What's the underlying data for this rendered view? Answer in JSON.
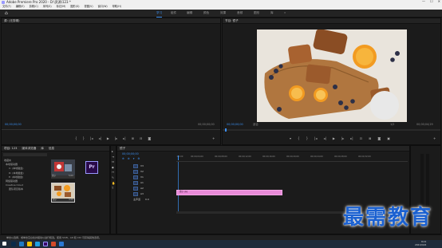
{
  "titlebar": {
    "title": "Adobe Premiere Pro 2020 - D:\\资源\\123 *",
    "min": "—",
    "max": "☐",
    "close": "✕"
  },
  "menu": [
    "文件(F)",
    "编辑(E)",
    "剪辑(C)",
    "序列(S)",
    "标记(M)",
    "图形(G)",
    "视图(V)",
    "窗口(W)",
    "帮助(H)"
  ],
  "workspaces": {
    "items": [
      "学习",
      "组件",
      "编辑",
      "颜色",
      "效果",
      "音频",
      "图形",
      "库"
    ],
    "active_index": 0,
    "more": "»"
  },
  "source_monitor": {
    "title": "源: (无剪辑)",
    "tc_left": "00;00;00;00",
    "tc_right": "00;00;00;00"
  },
  "program_monitor": {
    "title": "节目: 镜子",
    "tc_current": "00;00;00;00",
    "fit": "适合",
    "quality": "1/2",
    "tc_end": "00;00;04;29"
  },
  "project": {
    "tabs": [
      "项目: 123",
      "媒体浏览器",
      "库",
      "信息"
    ],
    "tree": [
      "收藏夹",
      "本地驱动器",
      "C: (本地磁盘)",
      "D: (本地磁盘)",
      "E: (本地磁盘)",
      "网络驱动器",
      "Creative Cloud",
      "团队项目版本"
    ],
    "bins": [
      {
        "name": "镜子",
        "duration": "5;00",
        "kind": "photo"
      },
      {
        "name": "Pr",
        "duration": "",
        "kind": "pr"
      },
      {
        "name": "镜子",
        "duration": "4;29",
        "kind": "food"
      }
    ],
    "pr_label": "Pr"
  },
  "timeline": {
    "title": "镜子",
    "timecode": "00;00;00;00",
    "ruler": [
      ":00;00",
      "00;00;04;00",
      "00;00;08;00",
      "00;00;12;00",
      "00;00;16;00",
      "00;00;20;00",
      "00;00;24;00",
      "00;00;28;00",
      "00;00;32;00"
    ],
    "video_tracks": [
      "V3",
      "V2",
      "V1"
    ],
    "audio_tracks": [
      "A1",
      "A2",
      "A3"
    ],
    "master": "主声道",
    "master_val": "0.0",
    "clip": "镜子.jpg"
  },
  "status": {
    "text": "单击以选择，或单击空白处并拖动以进行框选。使用 Shift、Alt 和 Ctrl 可获得其他选项。"
  },
  "watermark": "最需教育",
  "taskbar": {
    "time": "8:21",
    "date": "2021/9/24"
  }
}
